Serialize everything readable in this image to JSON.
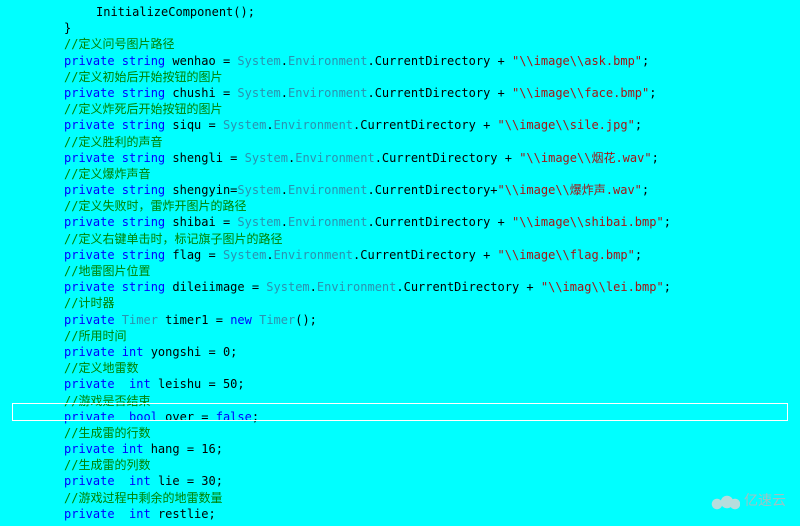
{
  "lines": [
    {
      "extraIndent": 32,
      "spans": [
        {
          "cls": "nm",
          "t": "InitializeComponent();"
        }
      ]
    },
    {
      "spans": [
        {
          "cls": "nm",
          "t": "}"
        }
      ]
    },
    {
      "spans": [
        {
          "cls": "cm",
          "t": "//定义问号图片路径"
        }
      ]
    },
    {
      "spans": [
        {
          "cls": "kw",
          "t": "private "
        },
        {
          "cls": "kw",
          "t": "string "
        },
        {
          "cls": "nm",
          "t": "wenhao = "
        },
        {
          "cls": "ty",
          "t": "System"
        },
        {
          "cls": "nm",
          "t": "."
        },
        {
          "cls": "ty",
          "t": "Environment"
        },
        {
          "cls": "nm",
          "t": ".CurrentDirectory + "
        },
        {
          "cls": "st",
          "t": "\"\\\\image\\\\ask.bmp\""
        },
        {
          "cls": "nm",
          "t": ";"
        }
      ]
    },
    {
      "spans": [
        {
          "cls": "cm",
          "t": "//定义初始后开始按钮的图片"
        }
      ]
    },
    {
      "spans": [
        {
          "cls": "kw",
          "t": "private "
        },
        {
          "cls": "kw",
          "t": "string "
        },
        {
          "cls": "nm",
          "t": "chushi = "
        },
        {
          "cls": "ty",
          "t": "System"
        },
        {
          "cls": "nm",
          "t": "."
        },
        {
          "cls": "ty",
          "t": "Environment"
        },
        {
          "cls": "nm",
          "t": ".CurrentDirectory + "
        },
        {
          "cls": "st",
          "t": "\"\\\\image\\\\face.bmp\""
        },
        {
          "cls": "nm",
          "t": ";"
        }
      ]
    },
    {
      "spans": [
        {
          "cls": "cm",
          "t": "//定义炸死后开始按钮的图片"
        }
      ]
    },
    {
      "spans": [
        {
          "cls": "kw",
          "t": "private "
        },
        {
          "cls": "kw",
          "t": "string "
        },
        {
          "cls": "nm",
          "t": "siqu = "
        },
        {
          "cls": "ty",
          "t": "System"
        },
        {
          "cls": "nm",
          "t": "."
        },
        {
          "cls": "ty",
          "t": "Environment"
        },
        {
          "cls": "nm",
          "t": ".CurrentDirectory + "
        },
        {
          "cls": "st",
          "t": "\"\\\\image\\\\sile.jpg\""
        },
        {
          "cls": "nm",
          "t": ";"
        }
      ]
    },
    {
      "spans": [
        {
          "cls": "cm",
          "t": "//定义胜利的声音"
        }
      ]
    },
    {
      "spans": [
        {
          "cls": "kw",
          "t": "private "
        },
        {
          "cls": "kw",
          "t": "string "
        },
        {
          "cls": "nm",
          "t": "shengli = "
        },
        {
          "cls": "ty",
          "t": "System"
        },
        {
          "cls": "nm",
          "t": "."
        },
        {
          "cls": "ty",
          "t": "Environment"
        },
        {
          "cls": "nm",
          "t": ".CurrentDirectory + "
        },
        {
          "cls": "st",
          "t": "\"\\\\image\\\\烟花.wav\""
        },
        {
          "cls": "nm",
          "t": ";"
        }
      ]
    },
    {
      "spans": [
        {
          "cls": "cm",
          "t": "//定义爆炸声音"
        }
      ]
    },
    {
      "spans": [
        {
          "cls": "kw",
          "t": "private "
        },
        {
          "cls": "kw",
          "t": "string "
        },
        {
          "cls": "nm",
          "t": "shengyin="
        },
        {
          "cls": "ty",
          "t": "System"
        },
        {
          "cls": "nm",
          "t": "."
        },
        {
          "cls": "ty",
          "t": "Environment"
        },
        {
          "cls": "nm",
          "t": ".CurrentDirectory+"
        },
        {
          "cls": "st",
          "t": "\"\\\\image\\\\爆炸声.wav\""
        },
        {
          "cls": "nm",
          "t": ";"
        }
      ]
    },
    {
      "spans": [
        {
          "cls": "cm",
          "t": "//定义失败时，雷炸开图片的路径"
        }
      ]
    },
    {
      "spans": [
        {
          "cls": "kw",
          "t": "private "
        },
        {
          "cls": "kw",
          "t": "string "
        },
        {
          "cls": "nm",
          "t": "shibai = "
        },
        {
          "cls": "ty",
          "t": "System"
        },
        {
          "cls": "nm",
          "t": "."
        },
        {
          "cls": "ty",
          "t": "Environment"
        },
        {
          "cls": "nm",
          "t": ".CurrentDirectory + "
        },
        {
          "cls": "st",
          "t": "\"\\\\image\\\\shibai.bmp\""
        },
        {
          "cls": "nm",
          "t": ";"
        }
      ]
    },
    {
      "spans": [
        {
          "cls": "cm",
          "t": "//定义右键单击时，标记旗子图片的路径"
        }
      ]
    },
    {
      "spans": [
        {
          "cls": "kw",
          "t": "private "
        },
        {
          "cls": "kw",
          "t": "string "
        },
        {
          "cls": "nm",
          "t": "flag = "
        },
        {
          "cls": "ty",
          "t": "System"
        },
        {
          "cls": "nm",
          "t": "."
        },
        {
          "cls": "ty",
          "t": "Environment"
        },
        {
          "cls": "nm",
          "t": ".CurrentDirectory + "
        },
        {
          "cls": "st",
          "t": "\"\\\\image\\\\flag.bmp\""
        },
        {
          "cls": "nm",
          "t": ";"
        }
      ]
    },
    {
      "spans": [
        {
          "cls": "cm",
          "t": "//地雷图片位置"
        }
      ]
    },
    {
      "spans": [
        {
          "cls": "kw",
          "t": "private "
        },
        {
          "cls": "kw",
          "t": "string "
        },
        {
          "cls": "nm",
          "t": "dileiimage = "
        },
        {
          "cls": "ty",
          "t": "System"
        },
        {
          "cls": "nm",
          "t": "."
        },
        {
          "cls": "ty",
          "t": "Environment"
        },
        {
          "cls": "nm",
          "t": ".CurrentDirectory + "
        },
        {
          "cls": "st",
          "t": "\"\\\\imag\\\\lei.bmp\""
        },
        {
          "cls": "nm",
          "t": ";"
        }
      ]
    },
    {
      "spans": [
        {
          "cls": "cm",
          "t": "//计时器"
        }
      ]
    },
    {
      "spans": [
        {
          "cls": "kw",
          "t": "private "
        },
        {
          "cls": "ty",
          "t": "Timer "
        },
        {
          "cls": "nm",
          "t": "timer1 = "
        },
        {
          "cls": "kw",
          "t": "new "
        },
        {
          "cls": "ty",
          "t": "Timer"
        },
        {
          "cls": "nm",
          "t": "();"
        }
      ]
    },
    {
      "spans": [
        {
          "cls": "cm",
          "t": "//所用时间"
        }
      ]
    },
    {
      "spans": [
        {
          "cls": "kw",
          "t": "private "
        },
        {
          "cls": "kw",
          "t": "int "
        },
        {
          "cls": "nm",
          "t": "yongshi = 0;"
        }
      ]
    },
    {
      "spans": [
        {
          "cls": "cm",
          "t": "//定义地雷数"
        }
      ]
    },
    {
      "spans": [
        {
          "cls": "kw",
          "t": "private  "
        },
        {
          "cls": "kw",
          "t": "int "
        },
        {
          "cls": "nm",
          "t": "leishu = 50;"
        }
      ]
    },
    {
      "spans": [
        {
          "cls": "cm",
          "t": "//游戏是否结束"
        }
      ]
    },
    {
      "spans": [
        {
          "cls": "kw",
          "t": "private  "
        },
        {
          "cls": "kw",
          "t": "bool "
        },
        {
          "cls": "nm",
          "t": "over = "
        },
        {
          "cls": "kw",
          "t": "false"
        },
        {
          "cls": "nm",
          "t": ";"
        }
      ]
    },
    {
      "spans": [
        {
          "cls": "cm",
          "t": "//生成雷的行数"
        }
      ]
    },
    {
      "spans": [
        {
          "cls": "kw",
          "t": "private "
        },
        {
          "cls": "kw",
          "t": "int "
        },
        {
          "cls": "nm",
          "t": "hang = 16;"
        }
      ]
    },
    {
      "spans": [
        {
          "cls": "cm",
          "t": "//生成雷的列数"
        }
      ]
    },
    {
      "spans": [
        {
          "cls": "kw",
          "t": "private  "
        },
        {
          "cls": "kw",
          "t": "int "
        },
        {
          "cls": "nm",
          "t": "lie = 30;"
        }
      ]
    },
    {
      "spans": [
        {
          "cls": "cm",
          "t": "//游戏过程中剩余的地雷数量"
        }
      ]
    },
    {
      "spans": [
        {
          "cls": "kw",
          "t": "private  "
        },
        {
          "cls": "kw",
          "t": "int "
        },
        {
          "cls": "nm",
          "t": "restlie;"
        }
      ]
    }
  ],
  "highlightLineIndex": 23,
  "watermark": "亿速云"
}
